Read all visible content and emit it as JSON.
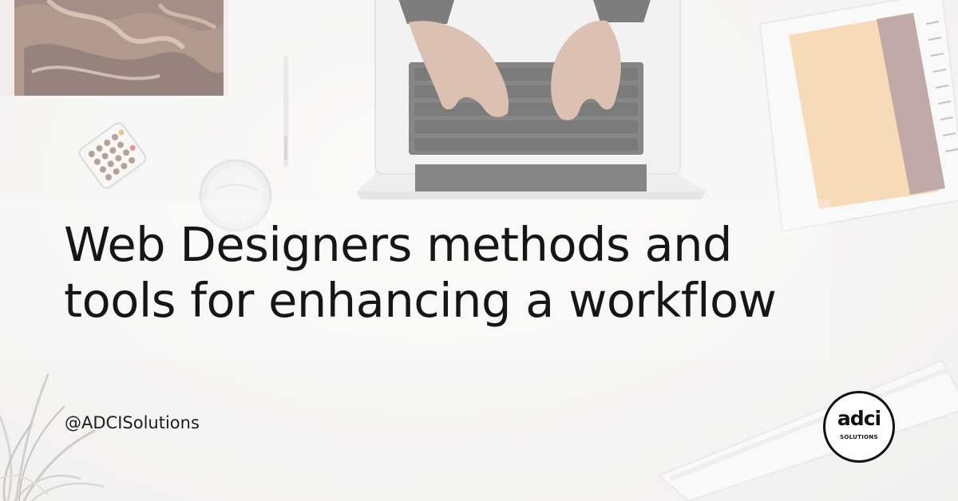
{
  "headline": {
    "line1": "Web Designers methods and",
    "line2": "tools for enhancing a workflow"
  },
  "social_handle": "@ADCISolutions",
  "logo": {
    "word": "adci",
    "sub": "SOLUTIONS"
  },
  "colors": {
    "background": "#f1f0ef",
    "text": "#161616",
    "notebook": "#f3c38c",
    "notebook_spine": "#9a7472",
    "painting": "#5b3d35"
  }
}
